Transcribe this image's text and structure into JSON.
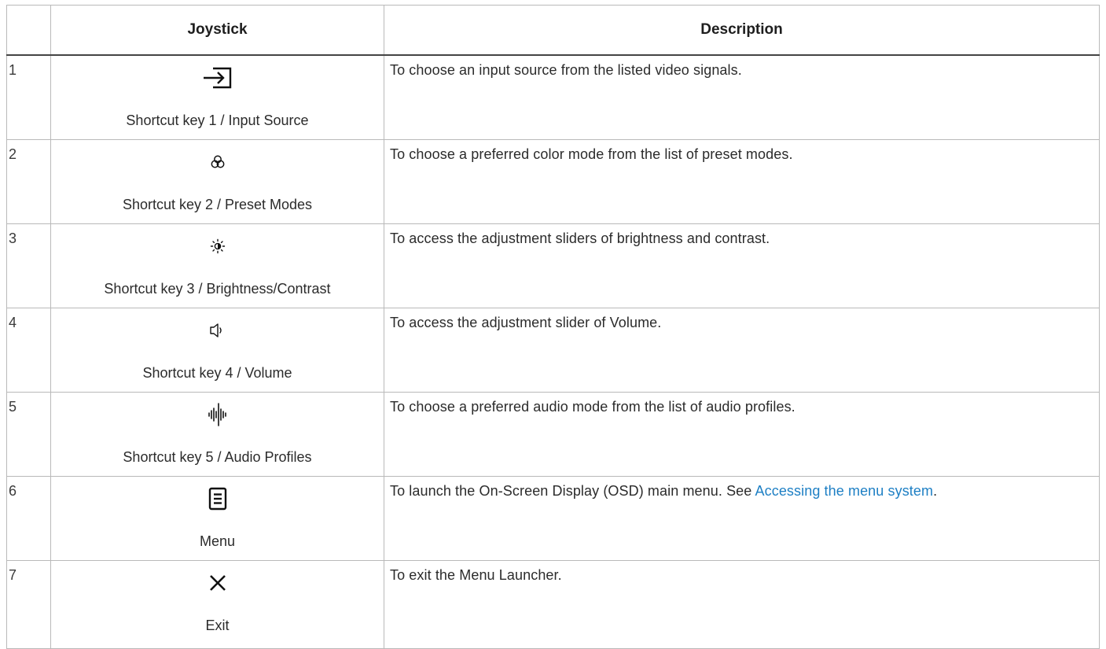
{
  "table": {
    "headers": [
      "",
      "Joystick",
      "Description"
    ],
    "rows": [
      {
        "num": "1",
        "icon": "input-source-icon",
        "label": "Shortcut key 1 / Input Source",
        "desc": "To choose an input source from the listed video signals."
      },
      {
        "num": "2",
        "icon": "preset-modes-icon",
        "label": "Shortcut key 2 / Preset Modes",
        "desc": "To choose a preferred color mode from the list of preset modes."
      },
      {
        "num": "3",
        "icon": "brightness-contrast-icon",
        "label": "Shortcut key 3 / Brightness/Contrast",
        "desc": "To access the adjustment sliders of brightness and contrast."
      },
      {
        "num": "4",
        "icon": "volume-icon",
        "label": "Shortcut key 4 / Volume",
        "desc": "To access the adjustment slider of Volume."
      },
      {
        "num": "5",
        "icon": "audio-profiles-icon",
        "label": "Shortcut key 5 / Audio Profiles",
        "desc": "To choose a preferred audio mode from the list of audio profiles."
      },
      {
        "num": "6",
        "icon": "menu-icon",
        "label": "Menu",
        "desc_before": "To launch the On-Screen Display (OSD) main menu. See ",
        "desc_link": "Accessing the menu system",
        "desc_after": "."
      },
      {
        "num": "7",
        "icon": "close-icon",
        "label": "Exit",
        "desc": "To exit the Menu Launcher."
      }
    ]
  },
  "colors": {
    "link": "#1d7fc4",
    "border": "#b9b9b9",
    "header_rule": "#444444",
    "text": "#2b2b2b"
  }
}
